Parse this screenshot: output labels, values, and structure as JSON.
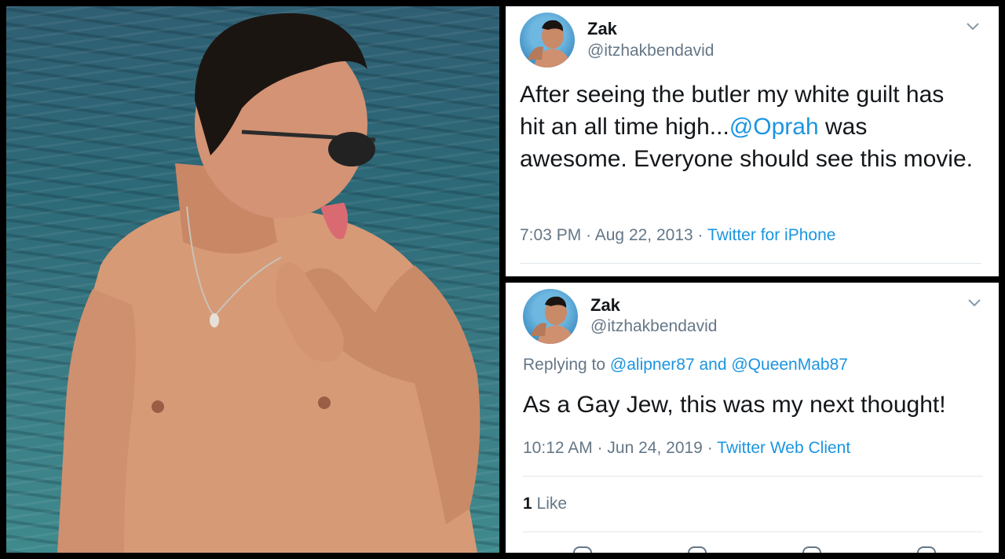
{
  "photo": {
    "description_icon": "person-at-sea-photo"
  },
  "tweets": [
    {
      "name": "Zak",
      "handle": "@itzhakbendavid",
      "text_parts": {
        "before": "After seeing the butler my white guilt has hit an all time high...",
        "mention": "@Oprah",
        "after": " was awesome.  Everyone should see this movie."
      },
      "time": "7:03 PM",
      "date": "Aug 22, 2013",
      "separator": "·",
      "client": "Twitter for iPhone"
    },
    {
      "name": "Zak",
      "handle": "@itzhakbendavid",
      "replying_label": "Replying to",
      "reply_mention_1": "@alipner87",
      "reply_and": "and",
      "reply_mention_2": "@QueenMab87",
      "text": "As a Gay Jew, this was my next thought!",
      "time": "10:12 AM",
      "date": "Jun 24, 2019",
      "separator": "·",
      "client": "Twitter Web Client",
      "like_count": "1",
      "like_label": "Like"
    }
  ],
  "colors": {
    "link": "#1b95e0",
    "muted": "#657786",
    "text": "#14171a"
  },
  "icons": [
    "chevron-down-icon",
    "avatar"
  ]
}
